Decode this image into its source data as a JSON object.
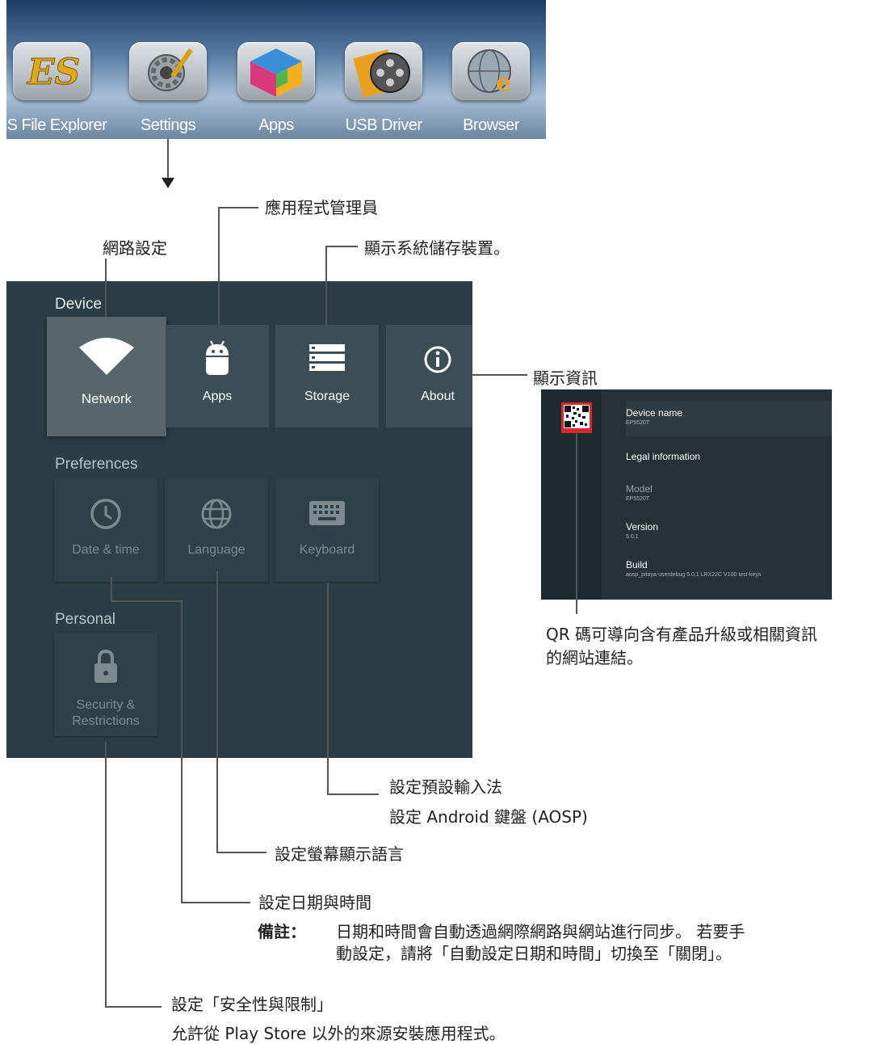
{
  "launcher": {
    "items": [
      {
        "label": "ES File Explorer",
        "icon": "es-file-explorer-icon"
      },
      {
        "label": "Settings",
        "icon": "settings-gear-icon"
      },
      {
        "label": "Apps",
        "icon": "apps-cube-icon"
      },
      {
        "label": "USB Driver",
        "icon": "usb-film-reel-icon"
      },
      {
        "label": "Browser",
        "icon": "browser-globe-icon"
      }
    ]
  },
  "settings": {
    "sections": {
      "device": "Device",
      "preferences": "Preferences",
      "personal": "Personal"
    },
    "device_tiles": [
      {
        "label": "Network",
        "icon": "wifi-icon"
      },
      {
        "label": "Apps",
        "icon": "android-icon"
      },
      {
        "label": "Storage",
        "icon": "storage-icon"
      },
      {
        "label": "About",
        "icon": "info-icon"
      }
    ],
    "preference_tiles": [
      {
        "label": "Date & time",
        "icon": "clock-icon"
      },
      {
        "label": "Language",
        "icon": "globe-icon"
      },
      {
        "label": "Keyboard",
        "icon": "keyboard-icon"
      }
    ],
    "personal_tiles": [
      {
        "label_line1": "Security &",
        "label_line2": "Restrictions",
        "icon": "lock-icon"
      }
    ]
  },
  "about_panel": {
    "rows": [
      {
        "title": "Device name",
        "value": "EP5520T"
      },
      {
        "title": "Legal information",
        "value": ""
      },
      {
        "title": "Model",
        "value": "EP5520T"
      },
      {
        "title": "Version",
        "value": "5.0.1"
      },
      {
        "title": "Build",
        "value": "aosp_pitaya-userdebug 5.0.1 LRX22C V100 test-keys"
      }
    ]
  },
  "annotations": {
    "apps_manager": "應用程式管理員",
    "network": "網路設定",
    "storage": "顯示系統儲存裝置。",
    "about": "顯示資訊",
    "qr_line1": "QR 碼可導向含有產品升級或相關資訊",
    "qr_line2": "的網站連結。",
    "keyboard_line1": "設定預設輸入法",
    "keyboard_line2": "設定 Android 鍵盤 (AOSP)",
    "language": "設定螢幕顯示語言",
    "datetime": "設定日期與時間",
    "note_label": "備註：",
    "note_line1": "日期和時間會自動透過網際網路與網站進行同步。 若要手",
    "note_line2": "動設定，請將「自動設定日期和時間」切換至「關閉」。",
    "security_line1": "設定「安全性與限制」",
    "security_line2": "允許從 Play Store 以外的來源安裝應用程式。"
  },
  "colors": {
    "panel_bg": "#2c3e45",
    "tile_bg": "#3c4e55",
    "tile_focus": "#56666c",
    "qr_accent": "#d9262c"
  }
}
